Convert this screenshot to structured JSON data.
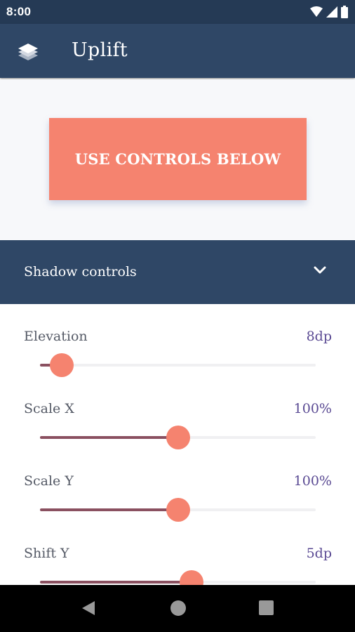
{
  "status_bar": {
    "time": "8:00"
  },
  "app_bar": {
    "title": "Uplift",
    "logo_icon": "layers-icon"
  },
  "preview": {
    "button_label": "USE CONTROLS BELOW",
    "button_color": "#f5836f"
  },
  "controls_panel": {
    "title": "Shadow controls",
    "toggle_icon": "chevron-down-icon"
  },
  "controls": [
    {
      "label": "Elevation",
      "value": "8dp",
      "fraction": 0.08
    },
    {
      "label": "Scale X",
      "value": "100%",
      "fraction": 0.5
    },
    {
      "label": "Scale Y",
      "value": "100%",
      "fraction": 0.5
    },
    {
      "label": "Shift Y",
      "value": "5dp",
      "fraction": 0.55
    }
  ],
  "colors": {
    "primary_dark": "#253a55",
    "primary": "#2f4766",
    "accent": "#f5836f",
    "value_text": "#5a4a93",
    "track_fill": "#8a5060"
  }
}
